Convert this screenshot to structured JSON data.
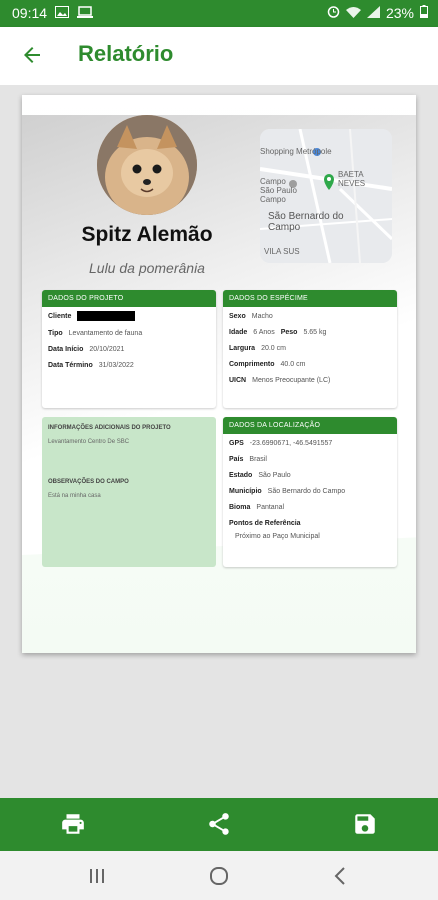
{
  "status_bar": {
    "time": "09:14",
    "battery": "23%"
  },
  "app_bar": {
    "title": "Relatório"
  },
  "report": {
    "pet_name": "Spitz Alemão",
    "pet_breed": "Lulu da pomerânia",
    "map": {
      "labels": [
        "Shopping Metrópole",
        "Campo São Paulo Campo",
        "BAETA NEVES",
        "São Bernardo do Campo",
        "VILA SUS"
      ]
    },
    "project": {
      "header": "DADOS DO PROJETO",
      "client_label": "Cliente",
      "type_label": "Tipo",
      "type_value": "Levantamento de fauna",
      "start_label": "Data Início",
      "start_value": "20/10/2021",
      "end_label": "Data Término",
      "end_value": "31/03/2022"
    },
    "species": {
      "header": "DADOS DO ESPÉCIME",
      "sex_label": "Sexo",
      "sex_value": "Macho",
      "age_label": "Idade",
      "age_value": "6 Anos",
      "weight_label": "Peso",
      "weight_value": "5.65 kg",
      "width_label": "Largura",
      "width_value": "20.0 cm",
      "length_label": "Comprimento",
      "length_value": "40.0 cm",
      "iucn_label": "UICN",
      "iucn_value": "Menos Preocupante (LC)"
    },
    "additional": {
      "header": "INFORMAÇÕES ADICIONAIS DO PROJETO",
      "text": "Levantamento Centro De SBC",
      "obs_header": "OBSERVAÇÕES DO CAMPO",
      "obs_text": "Está na minha casa"
    },
    "location": {
      "header": "DADOS DA LOCALIZAÇÃO",
      "gps_label": "GPS",
      "gps_value": "-23.6990671, -46.5491557",
      "country_label": "País",
      "country_value": "Brasil",
      "state_label": "Estado",
      "state_value": "São Paulo",
      "city_label": "Município",
      "city_value": "São Bernardo do Campo",
      "biome_label": "Bioma",
      "biome_value": "Pantanal",
      "ref_label": "Pontos de Referência",
      "ref_value": "Próximo ao Paço Municipal"
    }
  },
  "colors": {
    "primary": "#2e8b2e",
    "light_green": "#c8e6c9"
  },
  "icons": {
    "bottom_bar": [
      "print-icon",
      "share-icon",
      "save-icon"
    ],
    "nav_bar": [
      "recents-icon",
      "home-icon",
      "back-icon"
    ]
  }
}
